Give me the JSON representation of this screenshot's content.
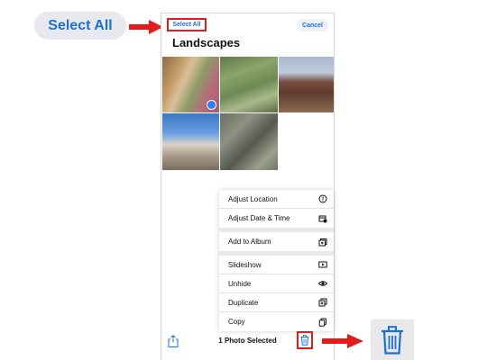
{
  "callout": {
    "select_all_label": "Select All"
  },
  "header": {
    "select_all_label": "Select All",
    "cancel_label": "Cancel",
    "album_title": "Landscapes"
  },
  "photos": [
    {
      "subject": "desert-path"
    },
    {
      "subject": "green-brush"
    },
    {
      "subject": "red-rock-ruins"
    },
    {
      "subject": "snowy-cliffs"
    },
    {
      "subject": "lizard"
    }
  ],
  "menu": {
    "groups": [
      [
        {
          "label": "Adjust Location",
          "icon": "info-icon"
        },
        {
          "label": "Adjust Date & Time",
          "icon": "calendar-clock-icon"
        }
      ],
      [
        {
          "label": "Add to Album",
          "icon": "add-to-album-icon"
        }
      ],
      [
        {
          "label": "Slideshow",
          "icon": "play-icon"
        },
        {
          "label": "Unhide",
          "icon": "eye-icon"
        },
        {
          "label": "Duplicate",
          "icon": "duplicate-icon"
        },
        {
          "label": "Copy",
          "icon": "copy-icon"
        }
      ]
    ]
  },
  "toolbar": {
    "selection_count": "1 Photo Selected",
    "share_icon": "share-icon",
    "trash_icon": "trash-icon"
  },
  "colors": {
    "accent": "#1f6fd1",
    "highlight": "#e21b1b",
    "pill_bg": "#e7e9ee"
  }
}
